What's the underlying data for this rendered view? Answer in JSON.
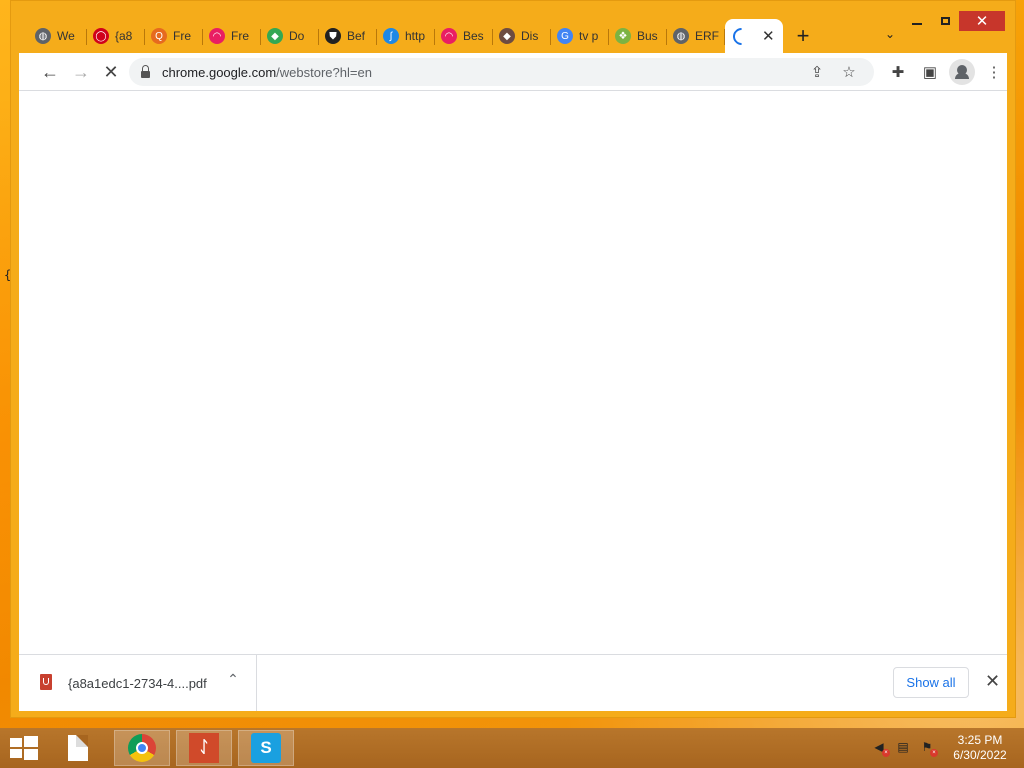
{
  "window": {
    "tabs": [
      {
        "label": "We",
        "icon": "globe-icon",
        "color": "#5f6368"
      },
      {
        "label": "{a8",
        "icon": "oracle-icon",
        "color": "#d0021b"
      },
      {
        "label": "Fre",
        "icon": "qualys-icon",
        "color": "#e66a1f"
      },
      {
        "label": "Fre",
        "icon": "colorful-swirl-icon",
        "color": "#e91e63"
      },
      {
        "label": "Do",
        "icon": "google-docs-icon",
        "color": "#34a853"
      },
      {
        "label": "Bef",
        "icon": "shield-icon",
        "color": "#222222"
      },
      {
        "label": "http",
        "icon": "link-icon",
        "color": "#1e88e5"
      },
      {
        "label": "Bes",
        "icon": "colorful-swirl-icon",
        "color": "#e91e63"
      },
      {
        "label": "Dis",
        "icon": "tag-icon",
        "color": "#6d4c41"
      },
      {
        "label": "tv p",
        "icon": "google-g-icon",
        "color": "#4285f4"
      },
      {
        "label": "Bus",
        "icon": "leaf-icon",
        "color": "#7cb342"
      },
      {
        "label": "ERF",
        "icon": "globe-icon",
        "color": "#5f6368"
      }
    ],
    "active_tab": {
      "icon": "loading-spinner-icon"
    },
    "new_tab_label": "+",
    "tab_search_label": "⌄"
  },
  "toolbar": {
    "url_host": "chrome.google.com",
    "url_path": "/webstore?hl=en"
  },
  "download_shelf": {
    "file_name": "{a8a1edc1-2734-4....pdf",
    "show_all_label": "Show all"
  },
  "taskbar": {
    "time": "3:25 PM",
    "date": "6/30/2022"
  },
  "colors": {
    "accent": "#1a73e8",
    "close_button": "#c7362b",
    "desktop": "#f7a007"
  }
}
